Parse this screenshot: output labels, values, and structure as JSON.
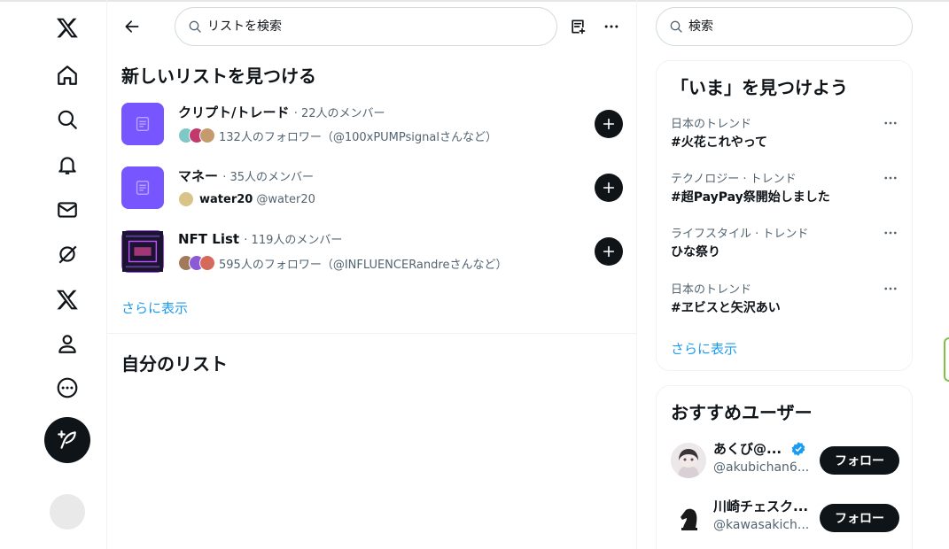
{
  "nav": {
    "items": [
      "x-logo-icon",
      "home-icon",
      "explore-icon",
      "notifications-icon",
      "messages-icon",
      "grok-icon",
      "premium-icon",
      "profile-icon",
      "more-icon"
    ]
  },
  "main": {
    "search_placeholder": "リストを検索",
    "discover_title": "新しいリストを見つける",
    "lists": [
      {
        "name": "クリプト/トレード",
        "members": "· 22人のメンバー",
        "owner_name": "",
        "sub": "132人のフォロワー（@100xPUMPsignalさんなど）"
      },
      {
        "name": "マネー",
        "members": "· 35人のメンバー",
        "owner_name": "water20",
        "sub": "@water20"
      },
      {
        "name": "NFT List",
        "members": "· 119人のメンバー",
        "owner_name": "",
        "sub": "595人のフォロワー（@INFLUENCERandreさんなど）"
      }
    ],
    "show_more": "さらに表示",
    "my_lists_title": "自分のリスト"
  },
  "side": {
    "search_placeholder": "検索",
    "trends_title": "「いま」を見つけよう",
    "trends": [
      {
        "category": "日本のトレンド",
        "name": "#火花これやって"
      },
      {
        "category": "テクノロジー · トレンド",
        "name": "#超PayPay祭開始しました"
      },
      {
        "category": "ライフスタイル · トレンド",
        "name": "ひな祭り"
      },
      {
        "category": "日本のトレンド",
        "name": "#ヱビスと矢沢あい"
      }
    ],
    "show_more": "さらに表示",
    "who_title": "おすすめユーザー",
    "users": [
      {
        "name": "あくび@...",
        "handle": "@akubichan6...",
        "follow": "フォロー",
        "verified": true
      },
      {
        "name": "川崎チェスク...",
        "handle": "@kawasakich...",
        "follow": "フォロー",
        "verified": false
      }
    ]
  },
  "colors": {
    "accent": "#1d9bf0",
    "list_purple": "#7856ff",
    "dark": "#0f1419",
    "muted": "#536471"
  }
}
